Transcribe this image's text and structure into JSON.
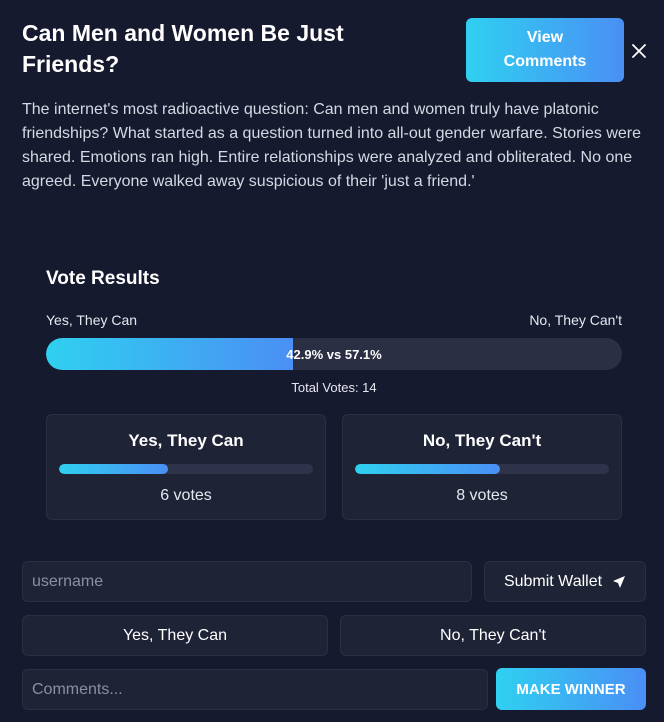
{
  "header": {
    "title": "Can Men and Women Be Just Friends?",
    "view_comments_label": "View Comments"
  },
  "description": "The internet's most radioactive question: Can men and women truly have platonic friendships? What started as a question turned into all-out gender warfare. Stories were shared. Emotions ran high. Entire relationships were analyzed and obliterated. No one agreed. Everyone walked away suspicious of their 'just a friend.'",
  "vote_results": {
    "title": "Vote Results",
    "option_a_label": "Yes, They Can",
    "option_b_label": "No, They Can't",
    "split_text": "42.9% vs 57.1%",
    "option_a_percent": 42.9,
    "option_b_percent": 57.1,
    "total_votes_text": "Total Votes: 14"
  },
  "cards": [
    {
      "title": "Yes, They Can",
      "percent": 42.9,
      "votes_text": "6 votes"
    },
    {
      "title": "No, They Can't",
      "percent": 57.1,
      "votes_text": "8 votes"
    }
  ],
  "form": {
    "username_placeholder": "username",
    "submit_wallet_label": "Submit Wallet",
    "vote_yes_label": "Yes, They Can",
    "vote_no_label": "No, They Can't",
    "comments_placeholder": "Comments...",
    "make_winner_label": "MAKE WINNER"
  },
  "colors": {
    "background": "#161a2e",
    "card": "#1f2336",
    "accent_start": "#2fd0f0",
    "accent_end": "#4a8ff5"
  }
}
